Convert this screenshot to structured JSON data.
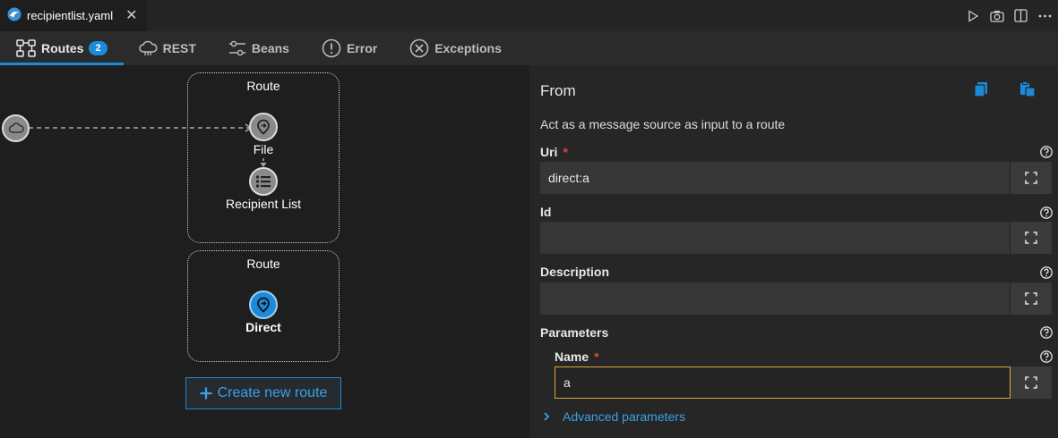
{
  "editor_tab": {
    "filename": "recipientlist.yaml",
    "close": "✕"
  },
  "nav": {
    "routes": {
      "label": "Routes",
      "count": "2"
    },
    "rest": {
      "label": "REST"
    },
    "beans": {
      "label": "Beans"
    },
    "error": {
      "label": "Error"
    },
    "exceptions": {
      "label": "Exceptions"
    }
  },
  "canvas": {
    "route1": {
      "title": "Route",
      "steps": [
        "File",
        "Recipient List"
      ]
    },
    "route2": {
      "title": "Route",
      "steps": [
        "Direct"
      ]
    },
    "create_route": "Create new route"
  },
  "panel": {
    "title": "From",
    "description": "Act as a message source as input to a route",
    "uri": {
      "label": "Uri",
      "required": "*",
      "value": "direct:a"
    },
    "id": {
      "label": "Id",
      "value": ""
    },
    "description_field": {
      "label": "Description",
      "value": ""
    },
    "parameters": {
      "label": "Parameters"
    },
    "name": {
      "label": "Name",
      "required": "*",
      "value": "a"
    },
    "advanced": "Advanced parameters"
  },
  "colors": {
    "accent": "#1d8ad9",
    "focus": "#e0a43a",
    "required": "#e0463b"
  }
}
